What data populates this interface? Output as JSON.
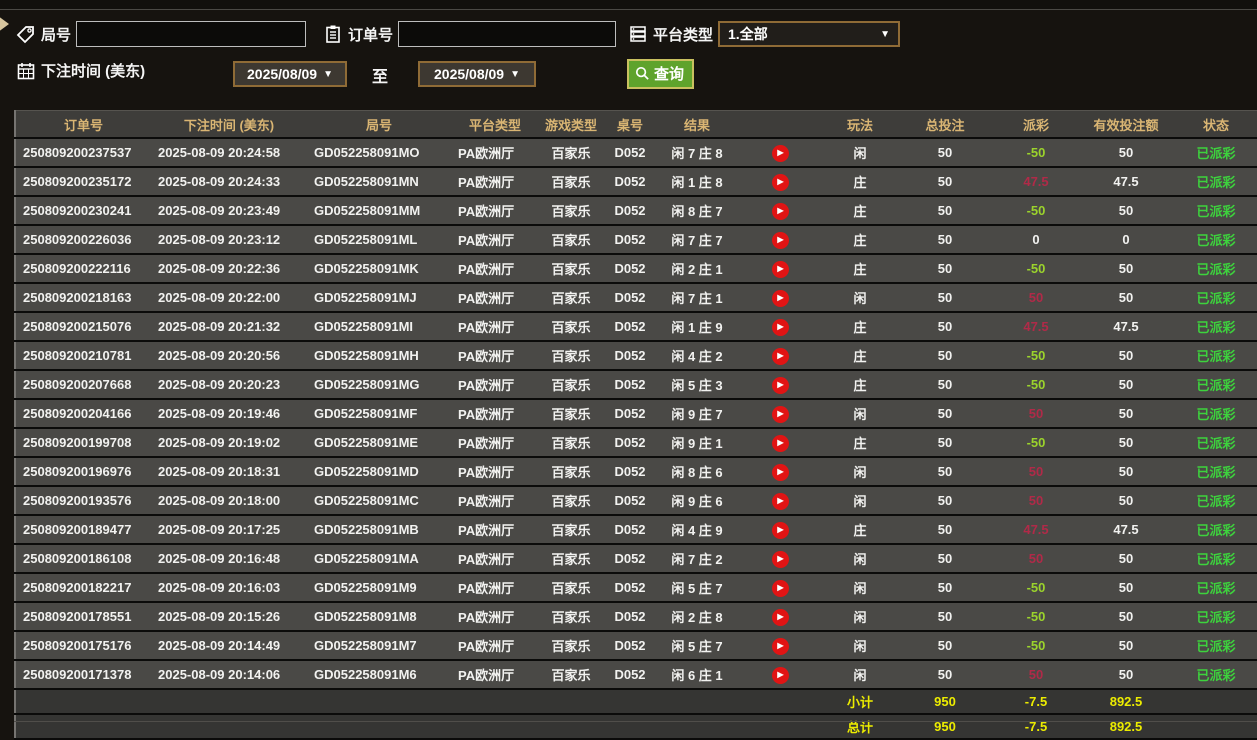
{
  "colors": {
    "bg": "#16130f",
    "rowbg": "#4a4946",
    "headbg": "#3e3d3a",
    "sumbg": "#353533",
    "gold": "#d9b573",
    "pos": "#b02a48",
    "neg": "#9bd32c",
    "status": "#3dd23d",
    "yellow": "#ecec00",
    "playred": "#e11414",
    "brown": "#8f6b36",
    "btngreen": "#5fa32c",
    "btnborder": "#c9c05f"
  },
  "icons": {
    "caret": "▼",
    "play": "▶"
  },
  "filters": {
    "round_label": "局号",
    "order_label": "订单号",
    "platform_label": "平台类型",
    "platform_value": "1.全部",
    "bet_time_label": "下注时间 (美东)",
    "date_from": "2025/08/09",
    "date_to": "2025/08/09",
    "to_label": "至",
    "search_label": "查询",
    "round_value": "",
    "order_value": ""
  },
  "table": {
    "headers": [
      "订单号",
      "下注时间 (美东)",
      "局号",
      "平台类型",
      "游戏类型",
      "桌号",
      "结果",
      "",
      "玩法",
      "总投注",
      "派彩",
      "有效投注额",
      "状态",
      ""
    ],
    "rows": [
      {
        "order": "250809200237537",
        "time": "2025-08-09 20:24:58",
        "round": "GD052258091MO",
        "platform": "PA欧洲厅",
        "game": "百家乐",
        "table": "D052",
        "result": "闲 7 庄 8",
        "bet": "闲",
        "total": "50",
        "payout": "-50",
        "tone": "neg",
        "valid": "50",
        "status": "已派彩"
      },
      {
        "order": "250809200235172",
        "time": "2025-08-09 20:24:33",
        "round": "GD052258091MN",
        "platform": "PA欧洲厅",
        "game": "百家乐",
        "table": "D052",
        "result": "闲 1 庄 8",
        "bet": "庄",
        "total": "50",
        "payout": "47.5",
        "tone": "pos",
        "valid": "47.5",
        "status": "已派彩"
      },
      {
        "order": "250809200230241",
        "time": "2025-08-09 20:23:49",
        "round": "GD052258091MM",
        "platform": "PA欧洲厅",
        "game": "百家乐",
        "table": "D052",
        "result": "闲 8 庄 7",
        "bet": "庄",
        "total": "50",
        "payout": "-50",
        "tone": "neg",
        "valid": "50",
        "status": "已派彩"
      },
      {
        "order": "250809200226036",
        "time": "2025-08-09 20:23:12",
        "round": "GD052258091ML",
        "platform": "PA欧洲厅",
        "game": "百家乐",
        "table": "D052",
        "result": "闲 7 庄 7",
        "bet": "庄",
        "total": "50",
        "payout": "0",
        "tone": "zero",
        "valid": "0",
        "status": "已派彩"
      },
      {
        "order": "250809200222116",
        "time": "2025-08-09 20:22:36",
        "round": "GD052258091MK",
        "platform": "PA欧洲厅",
        "game": "百家乐",
        "table": "D052",
        "result": "闲 2 庄 1",
        "bet": "庄",
        "total": "50",
        "payout": "-50",
        "tone": "neg",
        "valid": "50",
        "status": "已派彩"
      },
      {
        "order": "250809200218163",
        "time": "2025-08-09 20:22:00",
        "round": "GD052258091MJ",
        "platform": "PA欧洲厅",
        "game": "百家乐",
        "table": "D052",
        "result": "闲 7 庄 1",
        "bet": "闲",
        "total": "50",
        "payout": "50",
        "tone": "pos",
        "valid": "50",
        "status": "已派彩"
      },
      {
        "order": "250809200215076",
        "time": "2025-08-09 20:21:32",
        "round": "GD052258091MI",
        "platform": "PA欧洲厅",
        "game": "百家乐",
        "table": "D052",
        "result": "闲 1 庄 9",
        "bet": "庄",
        "total": "50",
        "payout": "47.5",
        "tone": "pos",
        "valid": "47.5",
        "status": "已派彩"
      },
      {
        "order": "250809200210781",
        "time": "2025-08-09 20:20:56",
        "round": "GD052258091MH",
        "platform": "PA欧洲厅",
        "game": "百家乐",
        "table": "D052",
        "result": "闲 4 庄 2",
        "bet": "庄",
        "total": "50",
        "payout": "-50",
        "tone": "neg",
        "valid": "50",
        "status": "已派彩"
      },
      {
        "order": "250809200207668",
        "time": "2025-08-09 20:20:23",
        "round": "GD052258091MG",
        "platform": "PA欧洲厅",
        "game": "百家乐",
        "table": "D052",
        "result": "闲 5 庄 3",
        "bet": "庄",
        "total": "50",
        "payout": "-50",
        "tone": "neg",
        "valid": "50",
        "status": "已派彩"
      },
      {
        "order": "250809200204166",
        "time": "2025-08-09 20:19:46",
        "round": "GD052258091MF",
        "platform": "PA欧洲厅",
        "game": "百家乐",
        "table": "D052",
        "result": "闲 9 庄 7",
        "bet": "闲",
        "total": "50",
        "payout": "50",
        "tone": "pos",
        "valid": "50",
        "status": "已派彩"
      },
      {
        "order": "250809200199708",
        "time": "2025-08-09 20:19:02",
        "round": "GD052258091ME",
        "platform": "PA欧洲厅",
        "game": "百家乐",
        "table": "D052",
        "result": "闲 9 庄 1",
        "bet": "庄",
        "total": "50",
        "payout": "-50",
        "tone": "neg",
        "valid": "50",
        "status": "已派彩"
      },
      {
        "order": "250809200196976",
        "time": "2025-08-09 20:18:31",
        "round": "GD052258091MD",
        "platform": "PA欧洲厅",
        "game": "百家乐",
        "table": "D052",
        "result": "闲 8 庄 6",
        "bet": "闲",
        "total": "50",
        "payout": "50",
        "tone": "pos",
        "valid": "50",
        "status": "已派彩"
      },
      {
        "order": "250809200193576",
        "time": "2025-08-09 20:18:00",
        "round": "GD052258091MC",
        "platform": "PA欧洲厅",
        "game": "百家乐",
        "table": "D052",
        "result": "闲 9 庄 6",
        "bet": "闲",
        "total": "50",
        "payout": "50",
        "tone": "pos",
        "valid": "50",
        "status": "已派彩"
      },
      {
        "order": "250809200189477",
        "time": "2025-08-09 20:17:25",
        "round": "GD052258091MB",
        "platform": "PA欧洲厅",
        "game": "百家乐",
        "table": "D052",
        "result": "闲 4 庄 9",
        "bet": "庄",
        "total": "50",
        "payout": "47.5",
        "tone": "pos",
        "valid": "47.5",
        "status": "已派彩"
      },
      {
        "order": "250809200186108",
        "time": "2025-08-09 20:16:48",
        "round": "GD052258091MA",
        "platform": "PA欧洲厅",
        "game": "百家乐",
        "table": "D052",
        "result": "闲 7 庄 2",
        "bet": "闲",
        "total": "50",
        "payout": "50",
        "tone": "pos",
        "valid": "50",
        "status": "已派彩"
      },
      {
        "order": "250809200182217",
        "time": "2025-08-09 20:16:03",
        "round": "GD052258091M9",
        "platform": "PA欧洲厅",
        "game": "百家乐",
        "table": "D052",
        "result": "闲 5 庄 7",
        "bet": "闲",
        "total": "50",
        "payout": "-50",
        "tone": "neg",
        "valid": "50",
        "status": "已派彩"
      },
      {
        "order": "250809200178551",
        "time": "2025-08-09 20:15:26",
        "round": "GD052258091M8",
        "platform": "PA欧洲厅",
        "game": "百家乐",
        "table": "D052",
        "result": "闲 2 庄 8",
        "bet": "闲",
        "total": "50",
        "payout": "-50",
        "tone": "neg",
        "valid": "50",
        "status": "已派彩"
      },
      {
        "order": "250809200175176",
        "time": "2025-08-09 20:14:49",
        "round": "GD052258091M7",
        "platform": "PA欧洲厅",
        "game": "百家乐",
        "table": "D052",
        "result": "闲 5 庄 7",
        "bet": "闲",
        "total": "50",
        "payout": "-50",
        "tone": "neg",
        "valid": "50",
        "status": "已派彩"
      },
      {
        "order": "250809200171378",
        "time": "2025-08-09 20:14:06",
        "round": "GD052258091M6",
        "platform": "PA欧洲厅",
        "game": "百家乐",
        "table": "D052",
        "result": "闲 6 庄 1",
        "bet": "闲",
        "total": "50",
        "payout": "50",
        "tone": "pos",
        "valid": "50",
        "status": "已派彩"
      }
    ],
    "subtotal": {
      "label": "小计",
      "total_bet": "950",
      "payout": "-7.5",
      "valid_bet": "892.5"
    },
    "total": {
      "label": "总计",
      "total_bet": "950",
      "payout": "-7.5",
      "valid_bet": "892.5"
    }
  }
}
